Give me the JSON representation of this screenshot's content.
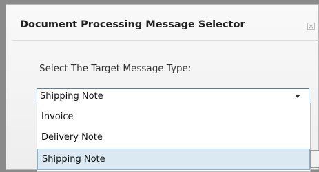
{
  "dialog": {
    "title": "Document Processing Message Selector",
    "close_icon": "close-icon",
    "prompt": "Select The Target Message Type:"
  },
  "select": {
    "value": "Shipping Note",
    "options": [
      "Invoice",
      "Delivery Note",
      "Shipping Note"
    ],
    "selected_index": 2
  },
  "colors": {
    "selected_option_background": "#dbeaf2",
    "selected_option_border": "#86b4d0",
    "select_border": "#5c7fa6"
  }
}
